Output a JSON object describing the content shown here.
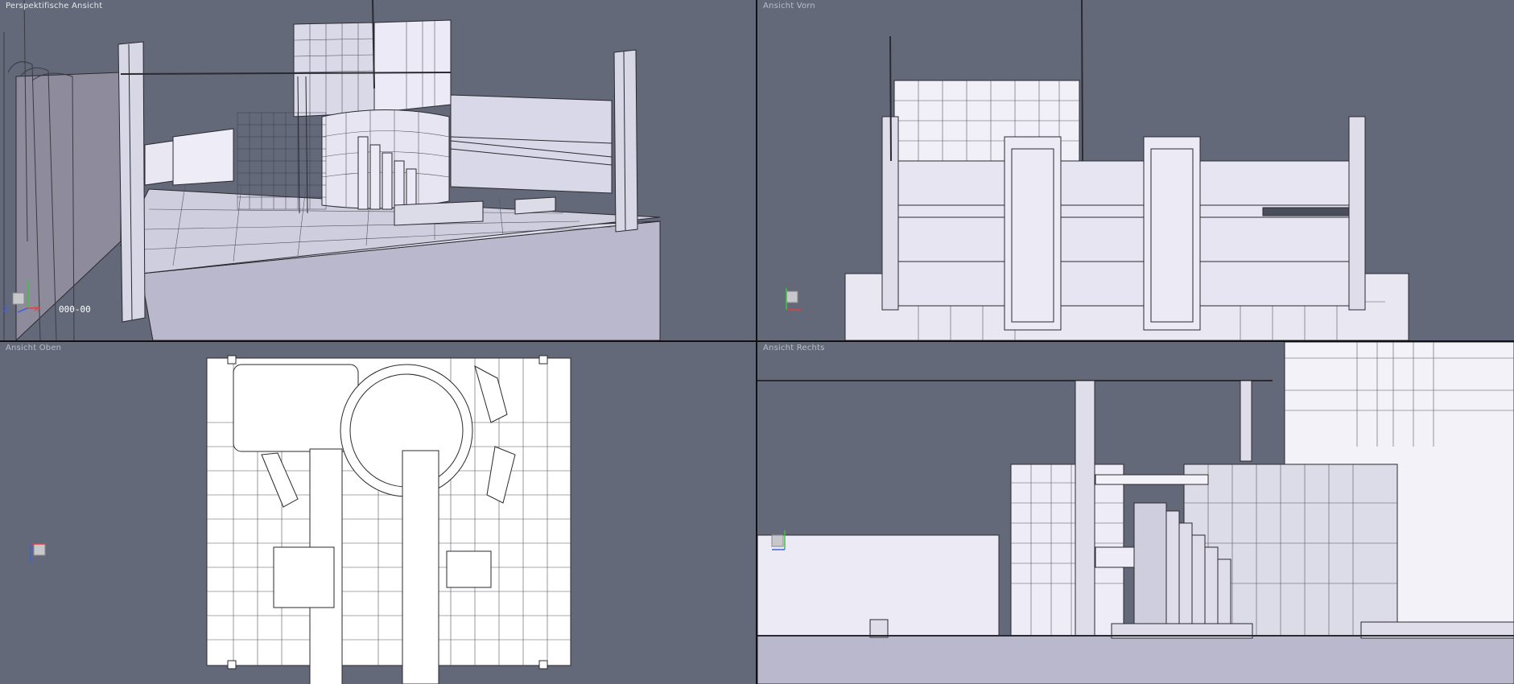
{
  "viewports": {
    "perspective": {
      "title": "Perspektifische Ansicht",
      "frame": "000-00"
    },
    "front": {
      "title": "Ansicht Vorn"
    },
    "top": {
      "title": "Ansicht Oben"
    },
    "right": {
      "title": "Ansicht Rechts"
    }
  },
  "axes": {
    "x": "X",
    "y": "Y",
    "z": "Z"
  },
  "colors": {
    "viewport_bg": "#64697a",
    "model_fill": "#e9e8f2",
    "line": "#2a2a30",
    "x_axis": "#e04040",
    "y_axis": "#40c040",
    "z_axis": "#4060e0"
  }
}
